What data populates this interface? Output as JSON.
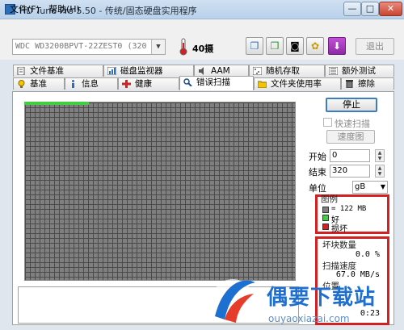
{
  "window": {
    "title": "HD Tune Pro 5.50 - 传统/固态硬盘实用程序",
    "min": "—",
    "max": "□",
    "close": "✕"
  },
  "menu": {
    "file": "文件(F)",
    "help": "帮助(H)"
  },
  "toolbar": {
    "disk": "WDC WD3200BPVT-22ZEST0 (320 gB)",
    "temperature": "40摄",
    "exit": "退出",
    "icons": [
      "copy-info-icon",
      "copy-info-icon",
      "camera-icon",
      "options-icon",
      "download-icon"
    ]
  },
  "tabs": {
    "row1": [
      {
        "label": "文件基准",
        "icon": "file-benchmark-icon"
      },
      {
        "label": "磁盘监视器",
        "icon": "disk-monitor-icon"
      },
      {
        "label": "AAM",
        "icon": "aam-icon"
      },
      {
        "label": "随机存取",
        "icon": "random-access-icon"
      },
      {
        "label": "额外测试",
        "icon": "extra-tests-icon"
      }
    ],
    "row2": [
      {
        "label": "基准",
        "icon": "benchmark-icon"
      },
      {
        "label": "信息",
        "icon": "info-icon"
      },
      {
        "label": "健康",
        "icon": "health-icon"
      },
      {
        "label": "错误扫描",
        "icon": "error-scan-icon"
      },
      {
        "label": "文件夹使用率",
        "icon": "folder-usage-icon"
      },
      {
        "label": "擦除",
        "icon": "erase-icon"
      }
    ],
    "active": "错误扫描"
  },
  "scan": {
    "stop": "停止",
    "quick_scan": "快速扫描",
    "speed_map": "速度图",
    "start_label": "开始",
    "start_value": "0",
    "end_label": "结束",
    "end_value": "320",
    "unit_label": "单位",
    "unit_value": "gB"
  },
  "legend": {
    "title": "图例",
    "block": "= 122 MB",
    "good": "好",
    "bad": "损坏",
    "colors": {
      "block": "#7f7f7f",
      "good": "#3fcf3f",
      "bad": "#d32121"
    }
  },
  "stats": {
    "bad_blocks_label": "坏块数量",
    "bad_blocks_value": "0.0 %",
    "speed_label": "扫描速度",
    "speed_value": "67.0 MB/s",
    "position_label": "位置",
    "elapsed_value": "0:23"
  },
  "watermark": {
    "text": "偶要下载站",
    "url": "ouyaoxiazai.com"
  }
}
